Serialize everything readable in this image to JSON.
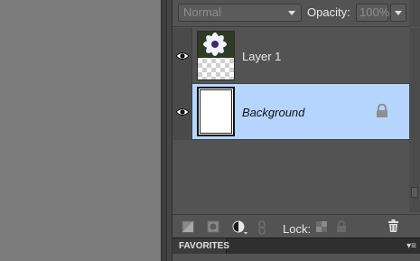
{
  "blend_mode": {
    "selected": "Normal"
  },
  "opacity": {
    "label": "Opacity:",
    "value": "100%"
  },
  "layers": [
    {
      "name": "Layer 1",
      "visible": true,
      "selected": false,
      "thumbnail": "flower-image"
    },
    {
      "name": "Background",
      "visible": true,
      "selected": true,
      "locked": true,
      "thumbnail": "white-fill"
    }
  ],
  "toolbar": {
    "lock_label": "Lock:",
    "icons": [
      "new-layer-icon",
      "add-mask-icon",
      "adjustment-layer-icon",
      "link-layers-icon",
      "lock-transparent-icon",
      "lock-all-icon",
      "trash-icon"
    ]
  },
  "favorites": {
    "tab_label": "FAVORITES",
    "menu_icon": "panel-menu-icon"
  },
  "colors": {
    "selection": "#b5d5ff",
    "panel_bg": "#535353",
    "canvas_bg": "#7b7b7b"
  }
}
